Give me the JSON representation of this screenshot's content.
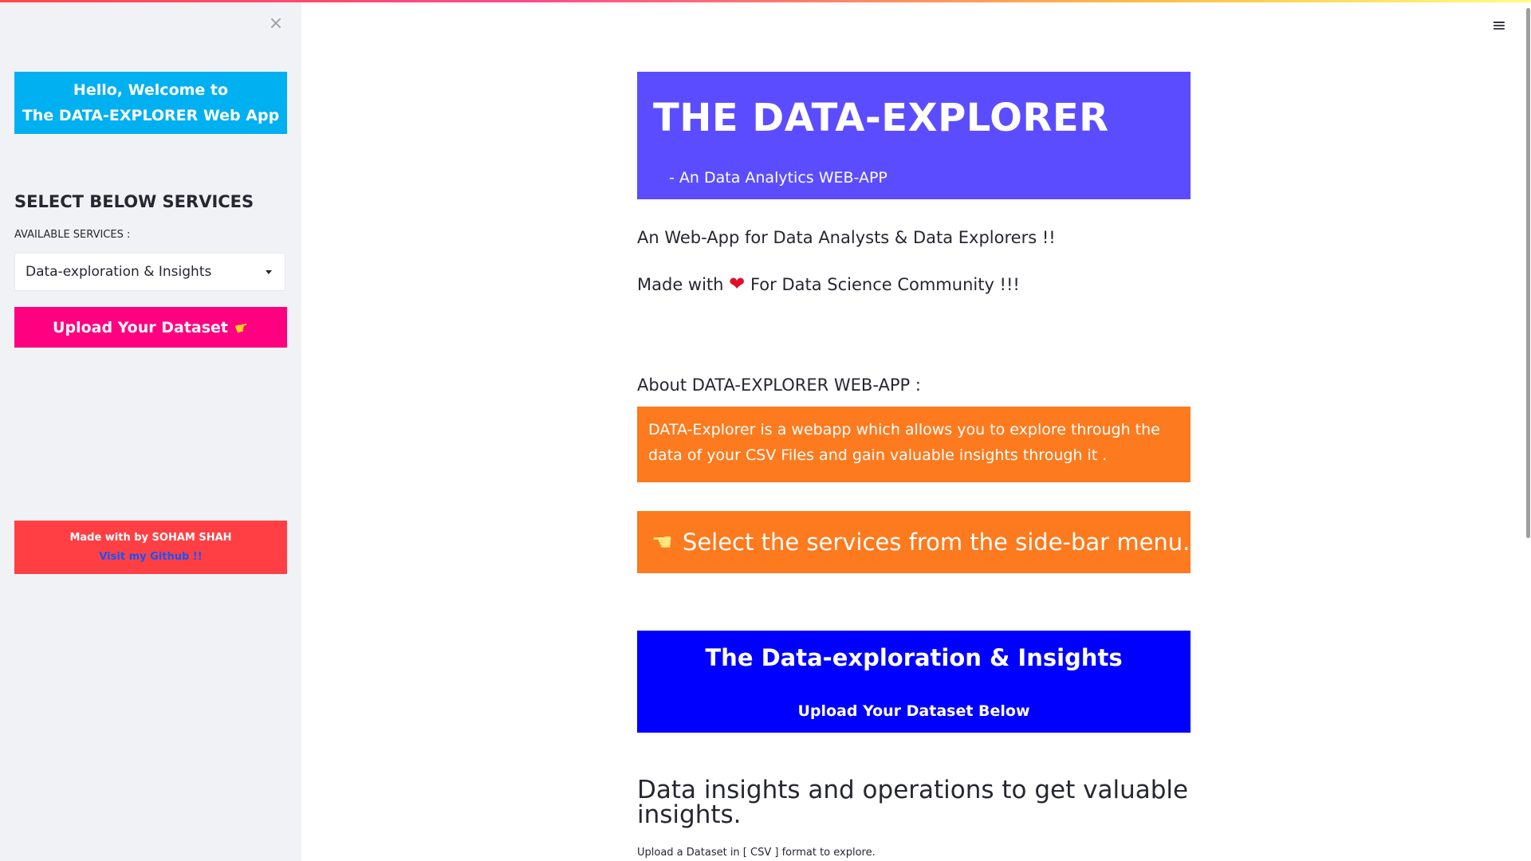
{
  "sidebar": {
    "close_glyph": "×",
    "welcome_line1": "Hello, Welcome to",
    "welcome_line2": "The DATA-EXPLORER Web App",
    "heading": "SELECT BELOW SERVICES",
    "select_label": "AVAILABLE SERVICES :",
    "select_value": "Data-exploration & Insights",
    "upload_button": "Upload Your Dataset",
    "upload_icon": "pointing-hand-icon",
    "footer_line1": "Made with  by SOHAM SHAH",
    "footer_link": "Visit my Github !!"
  },
  "header": {
    "menu_glyph": "≡"
  },
  "hero": {
    "title": "THE DATA-EXPLORER",
    "subtitle": "- An Data Analytics WEB-APP"
  },
  "main": {
    "intro_line": "An Web-App for Data Analysts & Data Explorers !!",
    "made_with_prefix": "Made with",
    "made_with_suffix": "For Data Science Community !!!",
    "about_label": "About DATA-EXPLORER WEB-APP :",
    "about_text": "DATA-Explorer is a webapp which allows you to explore through the data of your CSV Files and gain valuable insights through it .",
    "select_services_text": "Select the services from the side-bar menu.",
    "section_title": "The Data-exploration & Insights",
    "section_subtitle": "Upload Your Dataset Below",
    "insights_heading": "Data insights and operations to get valuable insights.",
    "csv_note": "Upload a Dataset in [ CSV ] format to explore."
  },
  "colors": {
    "welcome_bg": "#00b0f0",
    "upload_bg": "#ff0080",
    "footer_bg": "#ff3f44",
    "hero_bg": "#5b4dff",
    "orange_bg": "#fd7a1e",
    "blue_bg": "#0000ff",
    "sidebar_bg": "#f0f2f6"
  }
}
